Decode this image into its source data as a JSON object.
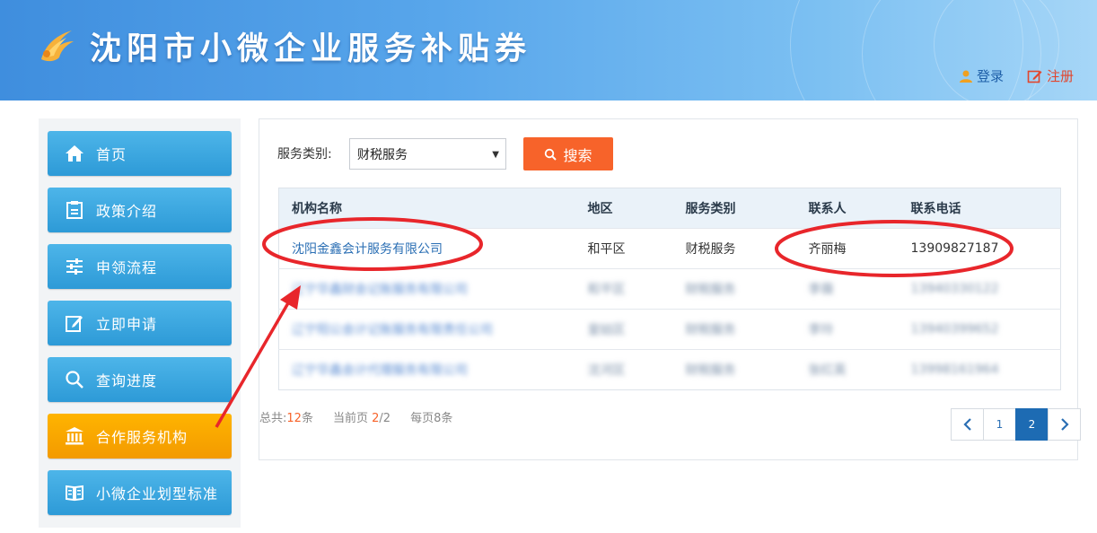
{
  "header": {
    "title": "沈阳市小微企业服务补贴券",
    "login_label": "登录",
    "register_label": "注册"
  },
  "sidebar": {
    "items": [
      {
        "label": "首页",
        "icon": "home-icon"
      },
      {
        "label": "政策介绍",
        "icon": "clipboard-icon"
      },
      {
        "label": "申领流程",
        "icon": "sliders-icon"
      },
      {
        "label": "立即申请",
        "icon": "edit-icon"
      },
      {
        "label": "查询进度",
        "icon": "search-icon"
      },
      {
        "label": "合作服务机构",
        "icon": "bank-icon",
        "active": true
      },
      {
        "label": "小微企业划型标准",
        "icon": "book-icon"
      }
    ]
  },
  "filter": {
    "label": "服务类别:",
    "selected": "财税服务",
    "search_label": "搜索"
  },
  "table": {
    "headers": [
      "机构名称",
      "地区",
      "服务类别",
      "联系人",
      "联系电话"
    ],
    "rows": [
      {
        "org": "沈阳金鑫会计服务有限公司",
        "region": "和平区",
        "category": "财税服务",
        "contact": "齐丽梅",
        "phone": "13909827187",
        "blurred": false
      },
      {
        "org": "辽宁华鑫财会记账服务有限公司",
        "region": "和平区",
        "category": "财税服务",
        "contact": "李薇",
        "phone": "13940330122",
        "blurred": true
      },
      {
        "org": "辽宁阳公会计记账服务有限责任公司",
        "region": "皇姑区",
        "category": "财税服务",
        "contact": "李玲",
        "phone": "13940399652",
        "blurred": true
      },
      {
        "org": "辽宁华鑫会计代理服务有限公司",
        "region": "沈河区",
        "category": "财税服务",
        "contact": "张红英",
        "phone": "13998161964",
        "blurred": true
      }
    ]
  },
  "summary": {
    "total_prefix": "总共:",
    "total": "12",
    "total_suffix": "条",
    "page_prefix": "当前页",
    "current_page": "2",
    "page_sep": "/",
    "total_pages": "2",
    "per_page": "每页8条"
  },
  "pagination": {
    "prev": "‹",
    "pages": [
      "1",
      "2"
    ],
    "next": "›"
  },
  "colors": {
    "nav_blue": "#2d9ad7",
    "nav_active": "#f39a00",
    "search_button": "#f7632a",
    "annotation_red": "#e8262b",
    "link_blue": "#2b6fb4"
  }
}
